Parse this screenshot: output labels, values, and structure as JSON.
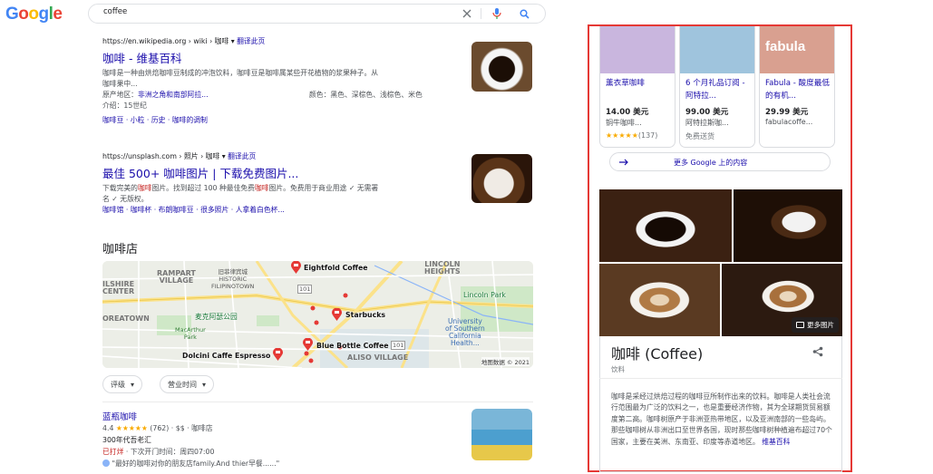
{
  "logo": "Google",
  "search": {
    "query": "coffee"
  },
  "results": [
    {
      "url": "https://en.wikipedia.org › wiki › 咖啡",
      "translate": "翻译此页",
      "title": "咖啡 - 维基百科",
      "snippet1": "咖啡是一种由烘焙咖啡豆制成的冲泡饮料，咖啡豆是咖啡属某些开花植物的浆果种子。从",
      "snippet2": "咖啡果中...",
      "attr1_label": "原产地区：",
      "attr1_value": "非洲之角和南部阿拉...",
      "attr2": "颜色：黑色、深棕色、浅棕色、米色",
      "attr3": "介绍：15世纪",
      "sitelinks": "咖啡豆 · 小粒 · 历史 · 咖啡的调制"
    },
    {
      "url": "https://unsplash.com › 照片 › 咖啡",
      "translate": "翻译此页",
      "title": "最佳 500+ 咖啡图片 | 下载免费图片...",
      "snippet1_a": "下载完美的",
      "snippet1_hl": "咖啡",
      "snippet1_b": "图片。找到超过 100 种最佳免费",
      "snippet1_hl2": "咖啡",
      "snippet1_c": "图片。免费用于商业用途 ✓ 无需署",
      "snippet2": "名 ✓ 无版权。",
      "sitelinks": "咖啡馆 · 咖啡杯 · 布朗咖啡豆 · 很多照片 · 人拿着白色杯..."
    }
  ],
  "local": {
    "heading": "咖啡店",
    "map_copyright": "地图数据 © 2021",
    "map_labels": [
      "Eightfold Coffee",
      "Starbucks",
      "Blue Bottle Coffee",
      "Dolcini Caffe Espresso",
      "Lincoln Park",
      "麦克阿瑟公园"
    ],
    "area_labels": [
      "RAMPART\nVILLAGE",
      "旧菲律宾城\nHISTORIC\nFILIPINOTOWN",
      "LINCOLN\nHEIGHTS",
      "ILSHIRE\nCENTER",
      "OREATOWN",
      "MacArthur\nPark",
      "University\nof Southern\nCalifornia\nHealth...",
      "ALISO VILLAGE",
      "101",
      "101"
    ],
    "chips": [
      "评级",
      "营业时间"
    ],
    "place": {
      "name": "蓝瓶咖啡",
      "rating": "4.4",
      "stars": "★★★★★",
      "reviews": "(762)",
      "meta": "· $$ · 咖啡店",
      "desc": "300年代吾老汇",
      "status": "已打烊",
      "hours": " · 下次开门时间：周四07:00",
      "review": "\"最好的咖啡对你的朋友店family.And thier早餐......\""
    }
  },
  "panel": {
    "products": [
      {
        "name": "薰衣草咖啡",
        "price": "14.00 美元",
        "seller": "铜牛咖啡...",
        "stars": "★★★★★",
        "reviews": "(137)",
        "img_color": "#c9b6de"
      },
      {
        "name": "6 个月礼品订阅 - 阿特拉...",
        "price": "99.00 美元",
        "seller": "阿特拉斯咖...",
        "extra": "免费送货",
        "img_color": "#9fc4dd"
      },
      {
        "name": "Fabula - 酸度最低的有机...",
        "price": "29.99 美元",
        "seller": "fabulacoffe...",
        "brand": "fabula",
        "img_color": "#d9a090"
      }
    ],
    "more_label": "更多 Google 上的内容",
    "more_images": "更多图片",
    "title": "咖啡 (Coffee)",
    "subtitle": "饮料",
    "description": "咖啡是采经过烘焙过程的咖啡豆所制作出来的饮料。咖啡是人类社会流行范围最为广泛的饮料之一，也是重要经济作物，其为全球期货贸易额度第二高。咖啡树原产于非洲亚热带地区，以及亚洲南部的一些岛屿。那些咖啡树从非洲出口至世界各国，现时那些咖啡树种植遍布超过70个国家，主要在美洲、东南亚、印度等赤道地区。",
    "wiki_link": "维基百科"
  }
}
